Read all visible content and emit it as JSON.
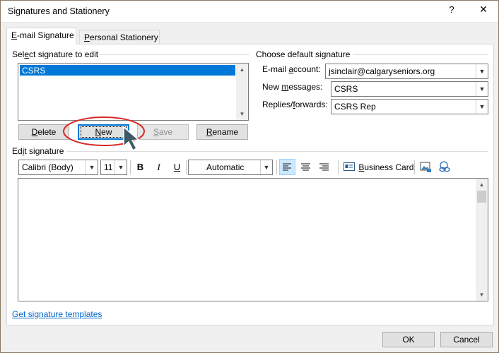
{
  "window": {
    "title": "Signatures and Stationery",
    "help_label": "?",
    "close_label": "✕"
  },
  "tabs": [
    {
      "label_pre": "",
      "label_accel": "E",
      "label_post": "-mail Signature",
      "active": true
    },
    {
      "label_pre": "",
      "label_accel": "P",
      "label_post": "ersonal Stationery",
      "active": false
    }
  ],
  "select_section": {
    "label_pre": "Sel",
    "label_accel": "e",
    "label_post": "ct signature to edit",
    "items": [
      "CSRS"
    ],
    "selected": "CSRS"
  },
  "buttons": {
    "delete": {
      "pre": "",
      "accel": "D",
      "post": "elete"
    },
    "new": {
      "pre": "",
      "accel": "N",
      "post": "ew"
    },
    "save": {
      "pre": "",
      "accel": "S",
      "post": "ave"
    },
    "rename": {
      "pre": "",
      "accel": "R",
      "post": "ename"
    },
    "ok": "OK",
    "cancel": "Cancel"
  },
  "default_signature": {
    "heading": "Choose default signature",
    "email_label": {
      "pre": "E-mail ",
      "accel": "a",
      "post": "ccount:"
    },
    "email_value": "jsinclair@calgaryseniors.org",
    "new_label": {
      "pre": "New ",
      "accel": "m",
      "post": "essages:"
    },
    "new_value": "CSRS",
    "replies_label": {
      "pre": "Replies/",
      "accel": "f",
      "post": "orwards:"
    },
    "replies_value": "CSRS Rep"
  },
  "edit_section": {
    "label_pre": "Ed",
    "label_accel": "i",
    "label_post": "t signature",
    "font": "Calibri (Body)",
    "size": "11",
    "bold": "B",
    "italic": "I",
    "underline": "U",
    "color": "Automatic",
    "business_card": {
      "pre": "",
      "accel": "B",
      "post": "usiness Card"
    },
    "align_selected": "left"
  },
  "templates_link": "Get signature templates",
  "annotation_color": "#d62b2b",
  "accent_color": "#0078d7"
}
